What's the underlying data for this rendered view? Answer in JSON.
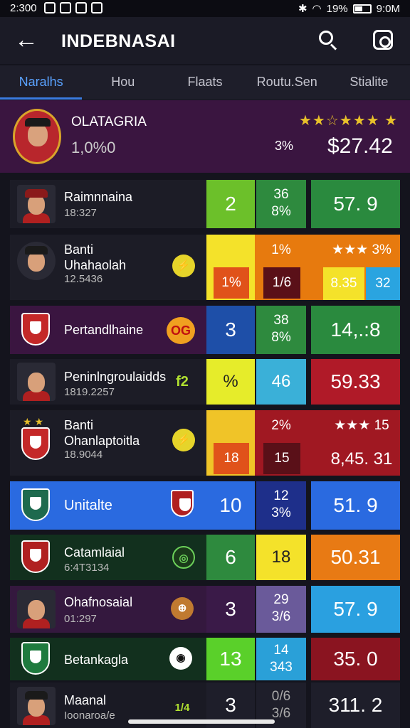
{
  "status": {
    "time": "2:300",
    "battery": "19%",
    "right_time": "9:0M"
  },
  "header": {
    "title": "INDEBNASAI"
  },
  "tabs": [
    "Naralhs",
    "Hou",
    "Flaats",
    "Routu.Sen",
    "Stialite"
  ],
  "hero": {
    "name": "OLATAGRIA",
    "percent": "1,0%0",
    "stars": "★★☆★★★ ★",
    "small": "3%",
    "price": "$27.42"
  },
  "rows": [
    {
      "name": "Raimnnaina",
      "sub": "18:327",
      "c1": "2",
      "c2a": "36",
      "c2b": "8%",
      "c3": "57. 9"
    },
    {
      "name": "Banti\nUhahaolah",
      "sub": "12.5436",
      "icon": "⚡",
      "c1a": "1%",
      "c1b": "1%",
      "c2b": "1/6",
      "c3a": "★★★ 3%",
      "c3b": "8.35",
      "c4b": "32"
    },
    {
      "name": "Pertandlhaine",
      "icon": "OG",
      "c1": "3",
      "c2a": "38",
      "c2b": "8%",
      "c3": "14,.:8"
    },
    {
      "name": "Peninlngroulaidds",
      "sub": "1819.2257",
      "icon": "f2",
      "c1": "%",
      "c2": "46",
      "c3": "59.33"
    },
    {
      "name": "Banti\nOhanlaptoitla",
      "sub": "18.9044",
      "icon": "⚡",
      "c1a": "2%",
      "c1b": "18",
      "c2b": "15",
      "c3a": "★★★ 15",
      "c3b": "8,45. 31"
    },
    {
      "name": "Unitalte",
      "c1": "10",
      "c2a": "12",
      "c2b": "3%",
      "c3": "51. 9"
    },
    {
      "name": "Catamlaial",
      "sub": "6:4T3134",
      "icon": "◎",
      "c1": "6",
      "c2": "18",
      "c3": "50.31"
    },
    {
      "name": "Ohafnosaial",
      "sub": "01:297",
      "icon": "⊕",
      "c1": "3",
      "c2a": "29",
      "c2b": "3/6",
      "c3": "57. 9"
    },
    {
      "name": "Betankagla",
      "icon": "◉",
      "c1": "13",
      "c2a": "14",
      "c2b": "343",
      "c3": "35. 0"
    },
    {
      "name": "Maanal",
      "sub": "Ioonaroa/e",
      "icon": "1/4",
      "c1": "3",
      "c2a": "0/6",
      "c2b": "3/6",
      "c3": "311. 2"
    }
  ]
}
